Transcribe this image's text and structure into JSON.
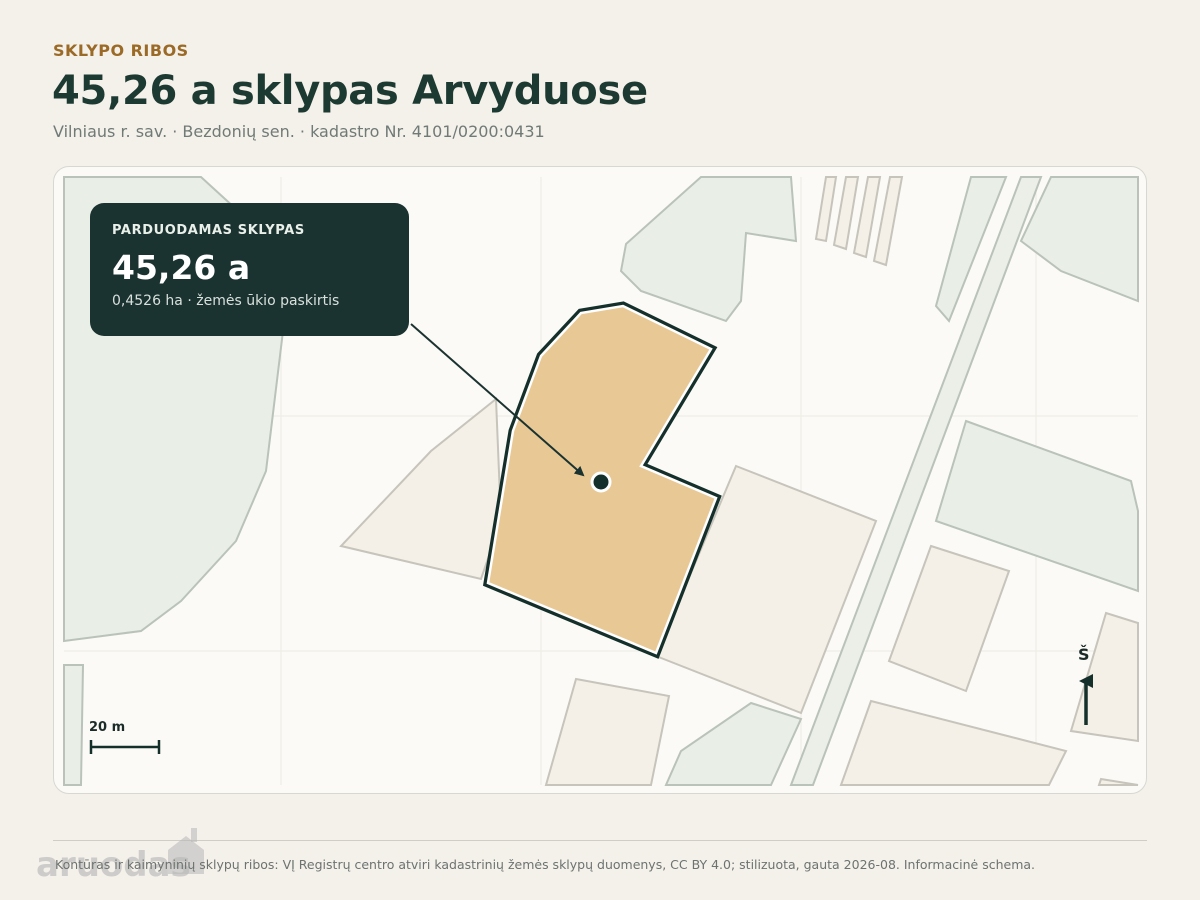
{
  "header": {
    "eyebrow": "SKLYPO RIBOS",
    "title": "45,26 a sklypas Arvyduose",
    "subtitle": "Vilniaus r. sav. · Bezdonių sen. · kadastro Nr. 4101/0200:0431"
  },
  "callout": {
    "eyebrow": "PARDUODAMAS SKLYPAS",
    "area": "45,26 a",
    "meta": "0,4526 ha · žemės ūkio paskirtis"
  },
  "map": {
    "scale_label": "20 m",
    "north_label": "Š",
    "icons": [
      "north-arrow-icon",
      "scale-bar-icon",
      "plot-marker-icon"
    ],
    "colors": {
      "plot_fill": "#e8c995",
      "plot_outline": "#15302b",
      "forest": "#e9eee6",
      "neighbor_plot": "#f4efe7",
      "road": "#eceee8"
    }
  },
  "footer": {
    "source": "Kontūras ir kaimyninių sklypų ribos: VĮ Registrų centro atviri kadastrinių žemės sklypų duomenys, CC BY 4.0; stilizuota, gauta 2026-08. Informacinė schema.",
    "watermark": "aruodas"
  }
}
